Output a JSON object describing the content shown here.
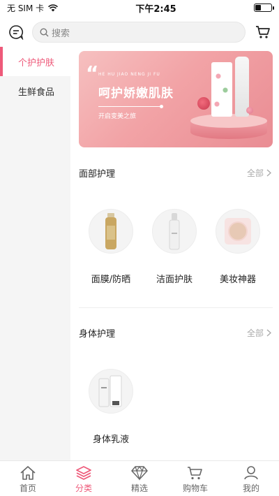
{
  "status": {
    "carrier": "无 SIM 卡",
    "time": "下午2:45",
    "battery_level": 0.35
  },
  "header": {
    "search_placeholder": "搜索",
    "icons": {
      "message": "message-icon",
      "cart": "cart-icon",
      "search": "search-icon"
    }
  },
  "sidebar": {
    "items": [
      {
        "label": "个护护肤",
        "active": true
      },
      {
        "label": "生鲜食品",
        "active": false
      }
    ]
  },
  "banner": {
    "pinyin": "HE HU JIAO NENG JI FU",
    "title": "呵护娇嫩肌肤",
    "subtitle": "开启变美之旅"
  },
  "sections": [
    {
      "title": "面部护理",
      "more": "全部",
      "items": [
        {
          "label": "面膜/防晒",
          "icon": "spray-bottle-icon"
        },
        {
          "label": "洁面护肤",
          "icon": "cleanser-bottle-icon"
        },
        {
          "label": "美妆神器",
          "icon": "cushion-compact-icon"
        }
      ]
    },
    {
      "title": "身体护理",
      "more": "全部",
      "items": [
        {
          "label": "身体乳液",
          "icon": "lotion-tube-icon"
        }
      ]
    }
  ],
  "tabbar": {
    "tabs": [
      {
        "label": "首页",
        "icon": "home-icon",
        "active": false
      },
      {
        "label": "分类",
        "icon": "layers-icon",
        "active": true
      },
      {
        "label": "精选",
        "icon": "diamond-icon",
        "active": false
      },
      {
        "label": "购物车",
        "icon": "cart-icon",
        "active": false
      },
      {
        "label": "我的",
        "icon": "user-icon",
        "active": false
      }
    ]
  },
  "colors": {
    "accent": "#ee5a7a",
    "sidebar_bg": "#f5f5f5",
    "banner": "#f2a3a6"
  }
}
